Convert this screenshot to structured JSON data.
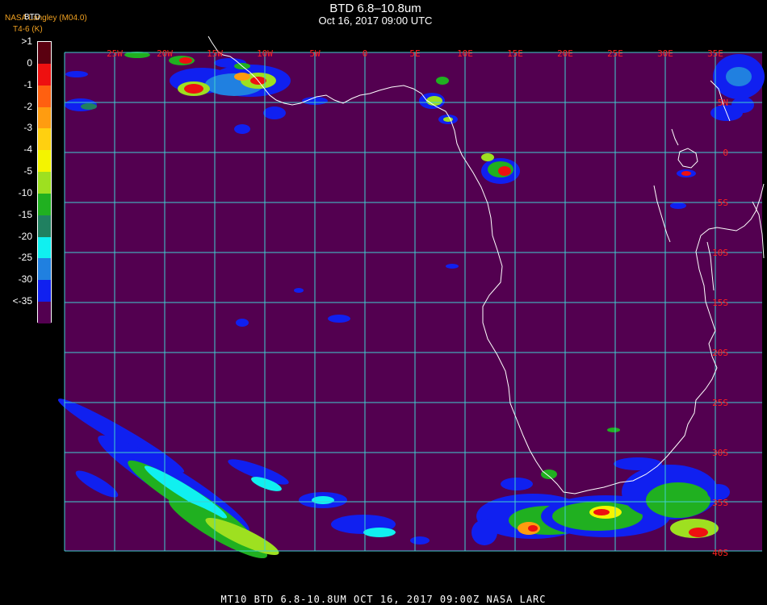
{
  "title": "BTD 6.8–10.8um",
  "subtitle": "Oct 16, 2017 09:00 UTC",
  "corner": {
    "source": "NASA Langley (M04.0)",
    "product": "BTD",
    "units": "T4-6 (K)"
  },
  "legend": {
    "entries": [
      {
        "label": ">1",
        "color": "#5a0010"
      },
      {
        "label": "0",
        "color": "#ee1010"
      },
      {
        "label": "-1",
        "color": "#ff6010"
      },
      {
        "label": "-2",
        "color": "#ff9c10"
      },
      {
        "label": "-3",
        "color": "#ffd010"
      },
      {
        "label": "-4",
        "color": "#f4f400"
      },
      {
        "label": "-5",
        "color": "#9ee020"
      },
      {
        "label": "-10",
        "color": "#20b020"
      },
      {
        "label": "-15",
        "color": "#208060"
      },
      {
        "label": "-20",
        "color": "#10f0f0"
      },
      {
        "label": "-25",
        "color": "#2080e0"
      },
      {
        "label": "-30",
        "color": "#1020f0"
      },
      {
        "label": "<-35",
        "color": "#530050"
      }
    ]
  },
  "map": {
    "background_color": "#530050",
    "grid_color": "#40d0d0",
    "label_color": "#ff2020",
    "lon_labels": [
      "25W",
      "20W",
      "15W",
      "10W",
      "5W",
      "0",
      "5E",
      "10E",
      "15E",
      "20E",
      "25E",
      "30E",
      "35E"
    ],
    "lat_labels": [
      "5N",
      "0",
      "5S",
      "10S",
      "15S",
      "20S",
      "25S",
      "30S",
      "35S",
      "40S"
    ]
  },
  "footer": "MT10  BTD 6.8-10.8UM   OCT 16, 2017 09:00Z   NASA LARC"
}
